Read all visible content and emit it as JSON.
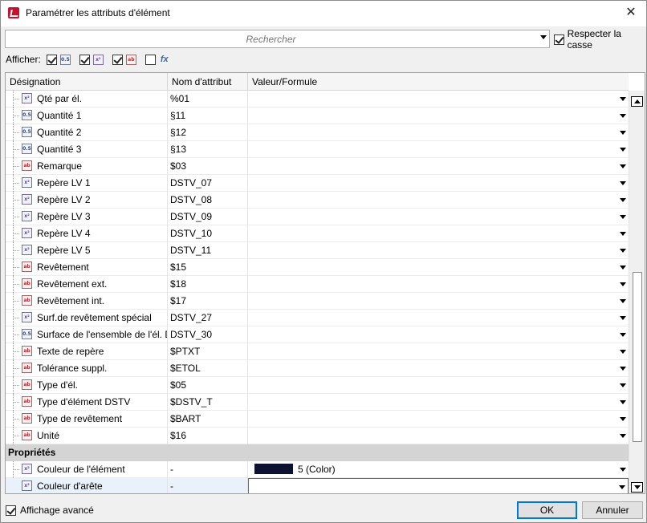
{
  "window": {
    "title": "Paramétrer les attributs d'élément",
    "close_glyph": "✕"
  },
  "search": {
    "placeholder": "Rechercher",
    "match_case_label": "Respecter la casse",
    "match_case_checked": true
  },
  "filter": {
    "label": "Afficher:",
    "toggles": [
      {
        "icon": "number-attribute-icon",
        "checked": true
      },
      {
        "icon": "formula-attribute-icon",
        "checked": true
      },
      {
        "icon": "text-attribute-icon",
        "checked": true
      },
      {
        "icon": "fx-function-icon",
        "checked": false
      }
    ],
    "fx_glyph": "fx"
  },
  "grid": {
    "columns": [
      "Désignation",
      "Nom d'attribut",
      "Valeur/Formule"
    ],
    "rows": [
      {
        "icon": "formula",
        "label": "Qté par él.",
        "attr": "%01",
        "value": ""
      },
      {
        "icon": "number",
        "label": "Quantité 1",
        "attr": "§11",
        "value": ""
      },
      {
        "icon": "number",
        "label": "Quantité 2",
        "attr": "§12",
        "value": ""
      },
      {
        "icon": "number",
        "label": "Quantité 3",
        "attr": "§13",
        "value": ""
      },
      {
        "icon": "text",
        "label": "Remarque",
        "attr": "$03",
        "value": ""
      },
      {
        "icon": "formula",
        "label": "Repère LV 1",
        "attr": "DSTV_07",
        "value": ""
      },
      {
        "icon": "formula",
        "label": "Repère LV 2",
        "attr": "DSTV_08",
        "value": ""
      },
      {
        "icon": "formula",
        "label": "Repère LV 3",
        "attr": "DSTV_09",
        "value": ""
      },
      {
        "icon": "formula",
        "label": "Repère LV 4",
        "attr": "DSTV_10",
        "value": ""
      },
      {
        "icon": "formula",
        "label": "Repère LV 5",
        "attr": "DSTV_11",
        "value": ""
      },
      {
        "icon": "text",
        "label": "Revêtement",
        "attr": "$15",
        "value": ""
      },
      {
        "icon": "text",
        "label": "Revêtement ext.",
        "attr": "$18",
        "value": ""
      },
      {
        "icon": "text",
        "label": "Revêtement int.",
        "attr": "$17",
        "value": ""
      },
      {
        "icon": "formula",
        "label": "Surf.de revêtement spécial",
        "attr": "DSTV_27",
        "value": ""
      },
      {
        "icon": "number",
        "label": "Surface de l'ensemble de l'él. D",
        "attr": "DSTV_30",
        "value": ""
      },
      {
        "icon": "text",
        "label": "Texte de repère",
        "attr": "$PTXT",
        "value": ""
      },
      {
        "icon": "text",
        "label": "Tolérance suppl.",
        "attr": "$ETOL",
        "value": ""
      },
      {
        "icon": "text",
        "label": "Type d'él.",
        "attr": "$05",
        "value": ""
      },
      {
        "icon": "text",
        "label": "Type d'élément DSTV",
        "attr": "$DSTV_T",
        "value": ""
      },
      {
        "icon": "text",
        "label": "Type de revêtement",
        "attr": "$BART",
        "value": ""
      },
      {
        "icon": "text",
        "label": "Unité",
        "attr": "$16",
        "value": ""
      }
    ],
    "group_label": "Propriétés",
    "property_rows": [
      {
        "icon": "formula",
        "label": "Couleur de l'élément",
        "attr": "-",
        "value": "5 (Color)",
        "swatch_color": "#0c1230"
      },
      {
        "icon": "formula",
        "label": "Couleur d'arête",
        "attr": "-",
        "value": ""
      }
    ]
  },
  "footer": {
    "advanced_label": "Affichage avancé",
    "advanced_checked": true,
    "ok_label": "OK",
    "cancel_label": "Annuler"
  },
  "colors": {
    "selection_row": "#e9f1fb",
    "group_header": "#d4d4d4",
    "default_button_border": "#0078d7"
  }
}
